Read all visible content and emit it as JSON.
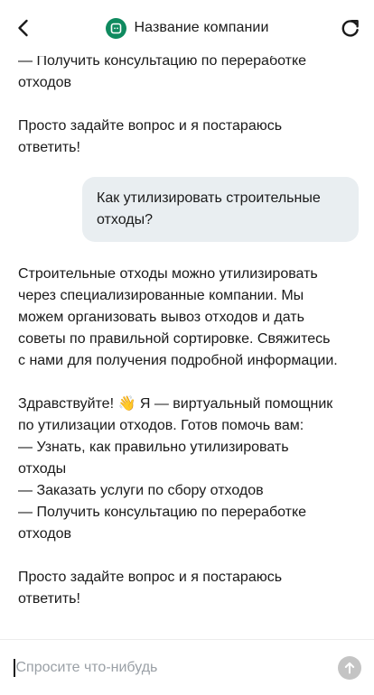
{
  "header": {
    "company_name": "Название компании",
    "back_icon": "chevron-left-icon",
    "refresh_icon": "refresh-icon",
    "logo_icon": "chat-bubble-icon",
    "logo_color": "#0f8a5f"
  },
  "messages": [
    {
      "role": "bot",
      "text": "— Получить консультацию по переработке\nотходов"
    },
    {
      "role": "bot",
      "text": "Просто задайте вопрос и я постараюсь\nответить!"
    },
    {
      "role": "user",
      "text": "Как утилизировать строительные\nотходы?"
    },
    {
      "role": "bot",
      "text": "Строительные отходы можно утилизировать\nчерез специализированные компании. Мы\nможем организовать вывоз отходов и дать\nсоветы по правильной сортировке. Свяжитесь\nс нами для получения подробной информации."
    },
    {
      "role": "bot",
      "text": "Здравствуйте! 👋 Я — виртуальный помощник\nпо утилизации отходов. Готов помочь вам:\n— Узнать, как правильно утилизировать\nотходы\n— Заказать услуги по сбору отходов\n— Получить консультацию по переработке\nотходов"
    },
    {
      "role": "bot",
      "text": "Просто задайте вопрос и я постараюсь\nответить!"
    }
  ],
  "composer": {
    "placeholder": "Спросите что-нибудь",
    "value": "",
    "send_icon": "arrow-up-icon"
  },
  "colors": {
    "user_bubble": "#e9eef1",
    "send_button_disabled": "#c4c4c4"
  }
}
